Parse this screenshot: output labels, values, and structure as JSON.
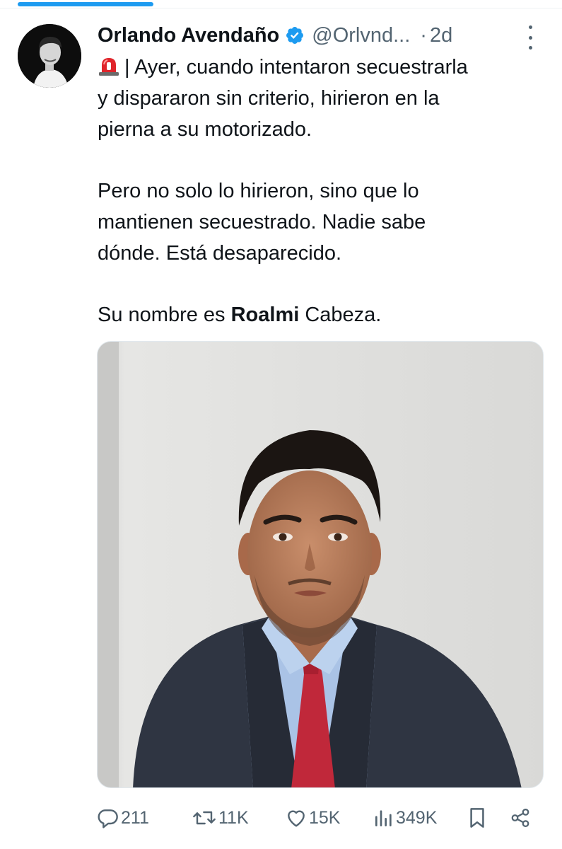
{
  "post": {
    "author_name": "Orlando Avendaño",
    "author_handle": "@Orlvnd...",
    "separator": "·",
    "time_ago": "2d",
    "text_lines_1": [
      "| Ayer, cuando intentaron secuestrarla",
      "y dispararon sin criterio, hirieron en la",
      "pierna a su motorizado."
    ],
    "text_lines_2": [
      "Pero no solo lo hirieron, sino que lo",
      "mantienen secuestrado. Nadie sabe",
      "dónde. Está desaparecido."
    ],
    "text_line_3_prefix": "Su nombre es ",
    "text_line_3_bold": "Roalmi",
    "text_line_3_suffix": " Cabeza.",
    "icons": {
      "verified": "verified-badge-icon",
      "siren": "siren-emoji-icon"
    }
  },
  "actions": {
    "replies": "211",
    "reposts": "11K",
    "likes": "15K",
    "views": "349K"
  },
  "colors": {
    "accent": "#1d9bf0",
    "text": "#0f1419",
    "secondary": "#536471",
    "tie": "#c0283a",
    "suit": "#2f3542",
    "shirt": "#aac3e6"
  }
}
